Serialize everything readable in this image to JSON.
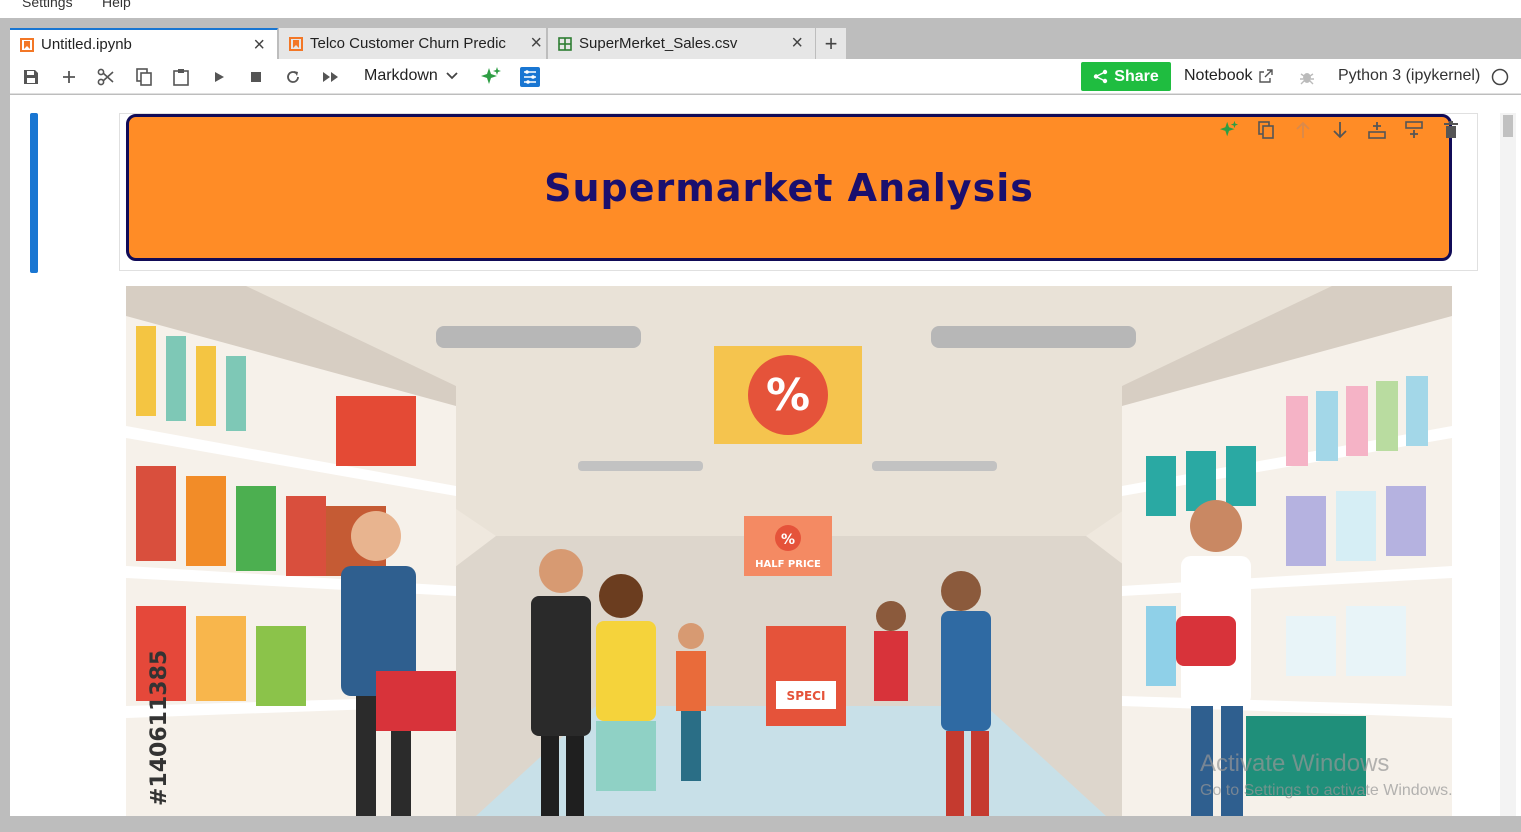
{
  "menu": {
    "items": [
      "Settings",
      "Help"
    ]
  },
  "tabs": [
    {
      "label": "Untitled.ipynb",
      "kind": "notebook",
      "active": true
    },
    {
      "label": "Telco Customer Churn Predic",
      "kind": "notebook",
      "active": false
    },
    {
      "label": "SuperMerket_Sales.csv",
      "kind": "csv",
      "active": false
    }
  ],
  "new_tab_label": "+",
  "toolbar": {
    "cell_type": "Markdown",
    "share_label": "Share",
    "notebook_label": "Notebook",
    "kernel_label": "Python 3 (ipykernel)",
    "icons": [
      "save-icon",
      "add-icon",
      "cut-icon",
      "copy-icon",
      "paste-icon",
      "run-icon",
      "stop-icon",
      "restart-icon",
      "run-all-icon",
      "ai-sparkle-icon",
      "property-inspector-icon"
    ]
  },
  "cell": {
    "banner_title": "Supermarket Analysis",
    "banner_color": "#ff8c26",
    "banner_border_color": "#110b57",
    "tools": [
      "ai-sparkle-icon",
      "duplicate-icon",
      "move-up-icon",
      "move-down-icon",
      "insert-above-icon",
      "insert-below-icon",
      "delete-icon"
    ]
  },
  "image": {
    "sign_half_price": "HALF PRICE",
    "sign_special": "SPECI\nOFFE",
    "stock_id": "#140611385"
  },
  "windows_watermark": {
    "line1": "Activate Windows",
    "line2": "Go to Settings to activate Windows."
  },
  "colors": {
    "accent": "#1976d2",
    "share": "#1fbd40"
  }
}
